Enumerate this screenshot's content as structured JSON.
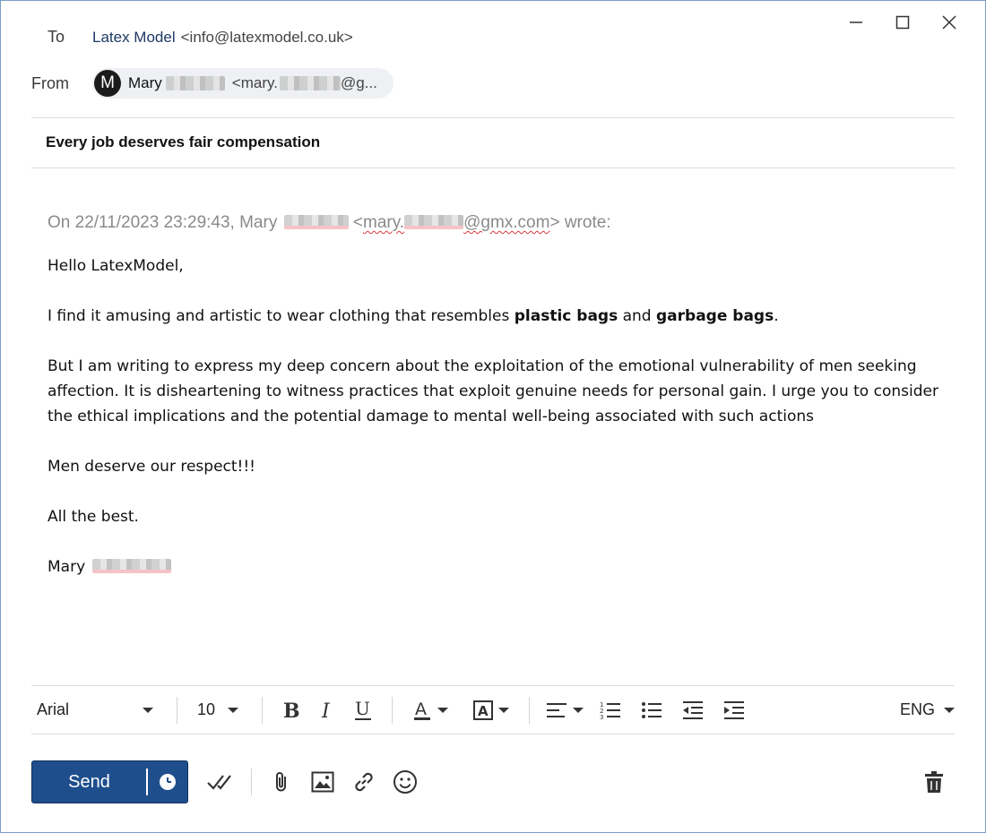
{
  "header": {
    "to_label": "To",
    "to_name": "Latex Model",
    "to_email": "<info@latexmodel.co.uk>",
    "from_label": "From",
    "from_avatar_letter": "M",
    "from_name": "Mary",
    "from_email_start": "<mary.",
    "from_email_end": "@g..."
  },
  "subject": "Every job deserves fair compensation",
  "body": {
    "quote_prefix": "On 22/11/2023 23:29:43, Mary",
    "quote_lt": "<",
    "quote_email_start": "mary.",
    "quote_email_domain": "@gmx.com",
    "quote_suffix": "> wrote:",
    "greeting": "Hello LatexModel,",
    "p1_start": "I find it amusing and artistic to wear clothing that resembles ",
    "p1_bold1": "plastic bags",
    "p1_mid": " and ",
    "p1_bold2": "garbage bags",
    "p1_end": ".",
    "p2": "But I am writing to express my deep concern about the exploitation of the emotional vulnerability of men seeking affection. It is disheartening to witness practices that exploit genuine needs for personal gain. I urge you to consider the ethical implications and the potential damage to mental well-being associated with such actions",
    "p3": "Men deserve our respect!!!",
    "p4": "All the best.",
    "signature": "Mary"
  },
  "toolbar": {
    "font": "Arial",
    "size": "10",
    "language": "ENG"
  },
  "actions": {
    "send_label": "Send"
  },
  "colors": {
    "accent": "#1f4e8c",
    "quote_text": "#8a8a8a",
    "spellcheck": "#d9383f"
  }
}
